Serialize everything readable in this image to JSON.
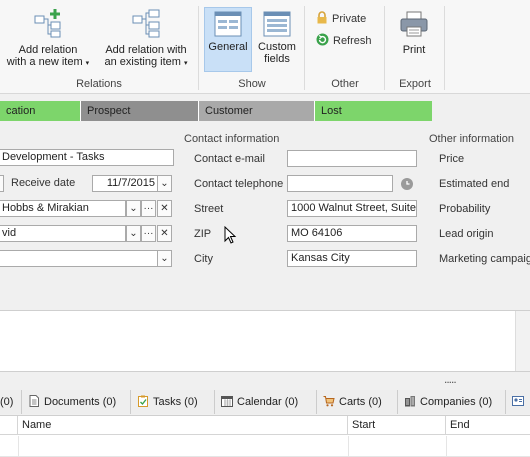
{
  "ribbon": {
    "add_relation_new": "Add relation\nwith a new item",
    "add_relation_new_l1": "Add relation",
    "add_relation_new_l2": "with a new item",
    "add_relation_existing_l1": "Add relation with",
    "add_relation_existing_l2": "an existing item",
    "general": "General",
    "custom_fields_l1": "Custom",
    "custom_fields_l2": "fields",
    "private": "Private",
    "refresh": "Refresh",
    "print": "Print",
    "groups": {
      "relations": "Relations",
      "show": "Show",
      "other": "Other",
      "export": "Export"
    }
  },
  "stages": [
    "cation",
    "Prospect",
    "Customer",
    "Lost"
  ],
  "form": {
    "subject_value": "Development - Tasks",
    "receive_date_label": "Receive date",
    "receive_date_value": "11/7/2015",
    "company_value": "Hobbs & Mirakian",
    "contact_value": "vid",
    "contact_info_header": "Contact information",
    "contact_email_label": "Contact e-mail",
    "contact_phone_label": "Contact telephone",
    "street_label": "Street",
    "street_value": "1000 Walnut Street, Suite",
    "zip_label": "ZIP",
    "zip_value": "MO 64106",
    "city_label": "City",
    "city_value": "Kansas City",
    "other_info_header": "Other information",
    "price_label": "Price",
    "estimated_end_label": "Estimated end",
    "probability_label": "Probability",
    "lead_origin_label": "Lead origin",
    "marketing_campaign_label": "Marketing campaign"
  },
  "tabs": [
    {
      "label": "(0)",
      "icon": "partial-tab-icon"
    },
    {
      "label": "Documents (0)",
      "icon": "document-icon"
    },
    {
      "label": "Tasks (0)",
      "icon": "task-icon"
    },
    {
      "label": "Calendar (0)",
      "icon": "calendar-icon"
    },
    {
      "label": "Carts (0)",
      "icon": "cart-icon"
    },
    {
      "label": "Companies (0)",
      "icon": "companies-icon"
    }
  ],
  "grid": {
    "columns": [
      "Name",
      "Start",
      "End"
    ]
  },
  "colors": {
    "stage_green": "#7dd56b",
    "stage_gray": "#8f8f8f",
    "selected": "#c9e0f7"
  }
}
